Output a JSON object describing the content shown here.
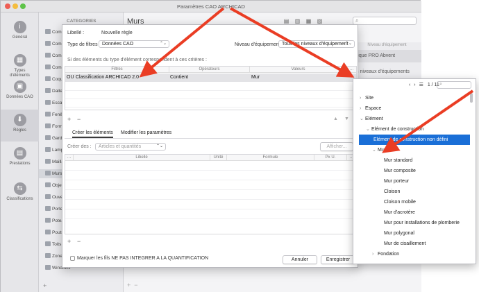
{
  "window": {
    "title": "Paramètres CAO ARCHICAD"
  },
  "nav": [
    {
      "label": "Général",
      "icon": "info-icon"
    },
    {
      "label": "Types d'éléments",
      "icon": "element-types-icon"
    },
    {
      "label": "Données CAO",
      "icon": "cad-data-icon"
    },
    {
      "label": "Règles",
      "icon": "rules-icon"
    },
    {
      "label": "Prestations",
      "icon": "services-icon"
    },
    {
      "label": "Classifications",
      "icon": "classifications-icon"
    }
  ],
  "categories": {
    "header": "CATEGORIES",
    "items": [
      "Compos",
      "Compos",
      "Compos",
      "Compos",
      "Coques",
      "Dalles",
      "Escalier",
      "Fenêtres",
      "Formes",
      "Gardes-c",
      "Lampes",
      "Maillage",
      "Murs",
      "Objets",
      "Ouvertur",
      "Portes",
      "Poteaux",
      "Poutres",
      "Toits",
      "Zones",
      "Windows"
    ],
    "selected_index": 12
  },
  "content": {
    "title": "Murs",
    "right_header": "Niveau d'équipement",
    "right_rows": [
      "èque PRO Abvent",
      "s niveaux d'équipements"
    ]
  },
  "dialog": {
    "libelle_label": "Libellé :",
    "libelle_value": "Nouvelle règle",
    "filter_type_label": "Type de filtres :",
    "filter_type_value": "Données CAO",
    "equip_label": "Niveau d'équipement :",
    "equip_value": "Tous les niveaux d'équipement",
    "criteria_text": "Si des éléments du type d'élément correspondent à ces critères :",
    "criteria_columns": [
      "Filtres",
      "Opérateurs",
      "Valeurs"
    ],
    "criteria_row": {
      "logic": "OU",
      "filter": "Classification ARCHICAD 2.0",
      "operator": "Contient",
      "value": "Mur"
    },
    "tabs": [
      "Créer les éléments",
      "Modifier les paramètres"
    ],
    "create_label": "Créer des :",
    "create_value": "Articles et quantités",
    "show_button": "Afficher...",
    "elements_columns": [
      "Libellé",
      "Unité",
      "Formule",
      "Px U."
    ],
    "checkbox_label": "Marquer les fils NE PAS INTEGRER A LA QUANTIFICATION",
    "cancel": "Annuler",
    "save": "Enregistrer"
  },
  "popup": {
    "pager": "1 / 11",
    "tree": [
      {
        "label": "Site",
        "level": 0,
        "toggle": "›"
      },
      {
        "label": "Espace",
        "level": 0,
        "toggle": "›"
      },
      {
        "label": "Elément",
        "level": 0,
        "toggle": "⌄"
      },
      {
        "label": "Elément de construction",
        "level": 1,
        "toggle": "⌄"
      },
      {
        "label": "Elément de construction non défini",
        "level": 2,
        "toggle": "",
        "highlight": true
      },
      {
        "label": "Mur",
        "level": 2,
        "toggle": "⌄"
      },
      {
        "label": "Mur standard",
        "level": 3,
        "toggle": ""
      },
      {
        "label": "Mur composite",
        "level": 3,
        "toggle": ""
      },
      {
        "label": "Mur porteur",
        "level": 3,
        "toggle": ""
      },
      {
        "label": "Cloison",
        "level": 3,
        "toggle": ""
      },
      {
        "label": "Cloison mobile",
        "level": 3,
        "toggle": ""
      },
      {
        "label": "Mur d'acrotère",
        "level": 3,
        "toggle": ""
      },
      {
        "label": "Mur pour installations de plomberie",
        "level": 3,
        "toggle": ""
      },
      {
        "label": "Mur polygonal",
        "level": 3,
        "toggle": ""
      },
      {
        "label": "Mur de cisaillement",
        "level": 3,
        "toggle": ""
      },
      {
        "label": "Fondation",
        "level": 2,
        "toggle": "›"
      }
    ]
  },
  "colors": {
    "accent": "#1a6fd7",
    "arrow": "#ea3d24"
  }
}
